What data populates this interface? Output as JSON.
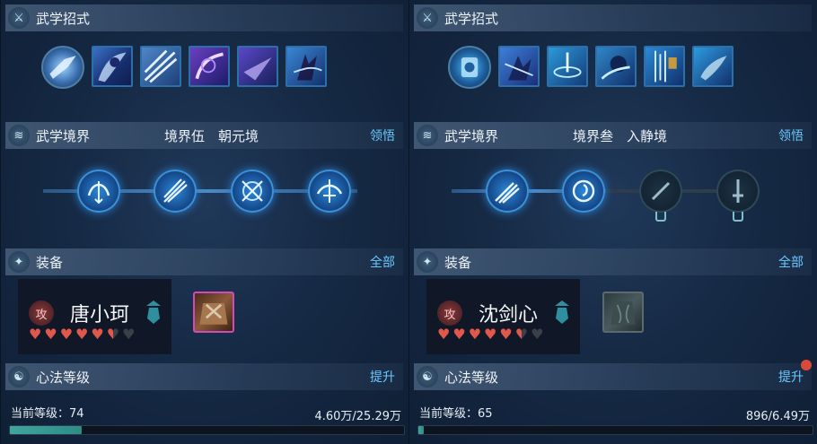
{
  "left": {
    "skills_title": "武学招式",
    "realm_title": "武学境界",
    "realm_level": "境界伍",
    "realm_name": "朝元境",
    "realm_action": "领悟",
    "equip_title": "装备",
    "equip_action": "全部",
    "char_badge": "攻",
    "char_name": "唐小珂",
    "hearts_filled": 5.5,
    "hearts_total": 7,
    "mind_title": "心法等级",
    "mind_action": "提升",
    "level_text": "当前等级：74",
    "progress_text": "4.60万/25.29万",
    "progress": 0.182
  },
  "right": {
    "skills_title": "武学招式",
    "realm_title": "武学境界",
    "realm_level": "境界叁",
    "realm_name": "入静境",
    "realm_action": "领悟",
    "equip_title": "装备",
    "equip_action": "全部",
    "char_badge": "攻",
    "char_name": "沈剑心",
    "hearts_filled": 5.5,
    "hearts_total": 7,
    "mind_title": "心法等级",
    "mind_action": "提升",
    "level_text": "当前等级：65",
    "progress_text": "896/6.49万",
    "progress": 0.014
  },
  "colors": {
    "accent": "#6bc8ff",
    "progress": "#3fa59d",
    "heart_filled": "#e0584a",
    "heart_empty": "#3a3f48",
    "notify": "#d84a3a"
  }
}
